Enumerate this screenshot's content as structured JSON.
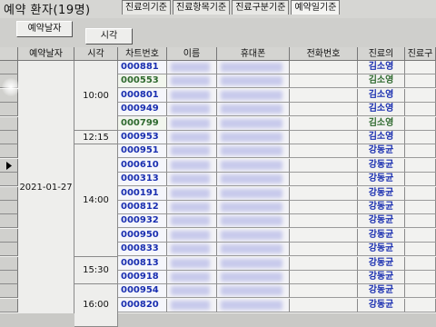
{
  "window": {
    "title": "예약 환자(19명)"
  },
  "tabs": [
    "진료의기준",
    "진료항목기준",
    "진료구분기준",
    "예약일기준"
  ],
  "active_tab": 3,
  "sort_buttons": {
    "date": "예약날자",
    "time": "시각"
  },
  "columns": [
    "예약날자",
    "시각",
    "차트번호",
    "이름",
    "휴대폰",
    "전화번호",
    "진료의",
    "진료구"
  ],
  "date_value": "2021-01-27",
  "time_groups": [
    {
      "label": "10:00",
      "rows": 5
    },
    {
      "label": "12:15",
      "rows": 1
    },
    {
      "label": "14:00",
      "rows": 8
    },
    {
      "label": "15:30",
      "rows": 2
    },
    {
      "label": "16:00",
      "rows": 3
    }
  ],
  "rows": [
    {
      "chart": "000881",
      "doctor": "김소영",
      "alt": false
    },
    {
      "chart": "000553",
      "doctor": "김소영",
      "alt": true
    },
    {
      "chart": "000801",
      "doctor": "김소영",
      "alt": false
    },
    {
      "chart": "000949",
      "doctor": "김소영",
      "alt": false
    },
    {
      "chart": "000799",
      "doctor": "김소영",
      "alt": true
    },
    {
      "chart": "000953",
      "doctor": "김소영",
      "alt": false
    },
    {
      "chart": "000951",
      "doctor": "강동균",
      "alt": false
    },
    {
      "chart": "000610",
      "doctor": "강동균",
      "alt": false
    },
    {
      "chart": "000313",
      "doctor": "강동균",
      "alt": false
    },
    {
      "chart": "000191",
      "doctor": "강동균",
      "alt": false
    },
    {
      "chart": "000812",
      "doctor": "강동균",
      "alt": false
    },
    {
      "chart": "000932",
      "doctor": "강동균",
      "alt": false
    },
    {
      "chart": "000950",
      "doctor": "강동균",
      "alt": false
    },
    {
      "chart": "000833",
      "doctor": "강동균",
      "alt": false
    },
    {
      "chart": "000813",
      "doctor": "강동균",
      "alt": false
    },
    {
      "chart": "000918",
      "doctor": "강동균",
      "alt": false
    },
    {
      "chart": "000954",
      "doctor": "강동균",
      "alt": false
    },
    {
      "chart": "000820",
      "doctor": "강동균",
      "alt": false
    }
  ],
  "current_row_index": 7
}
